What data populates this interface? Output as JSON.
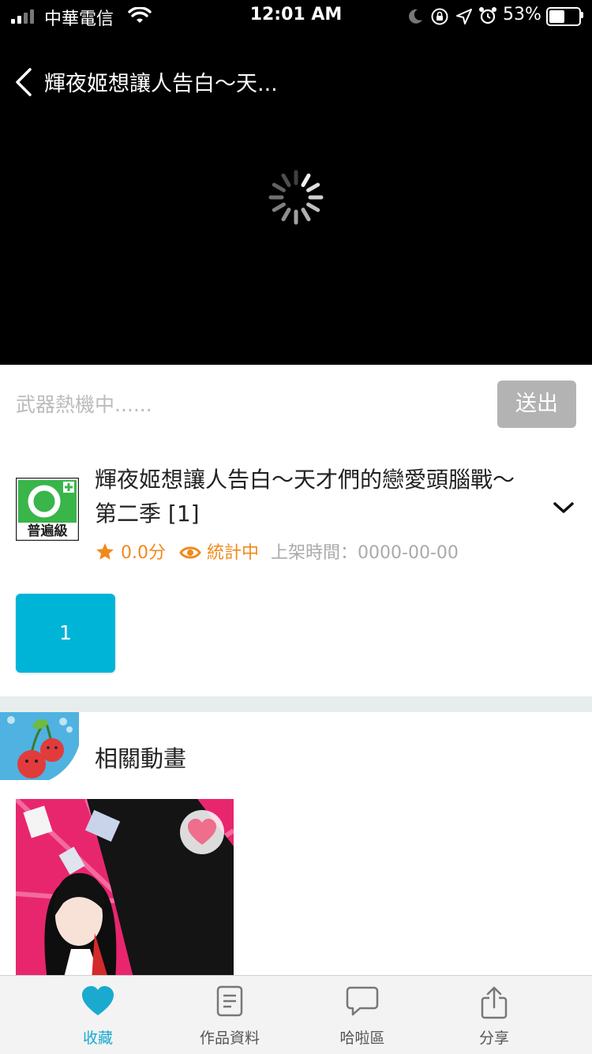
{
  "status_bar": {
    "carrier": "中華電信",
    "time": "12:01 AM",
    "battery_percent": "53%",
    "battery_level": 0.53
  },
  "nav": {
    "title": "輝夜姬想讓人告白～天...",
    "back_icon": "chevron-left-icon"
  },
  "player": {
    "state_icon": "loading-spinner-icon"
  },
  "danmaku": {
    "placeholder": "武器熱機中......",
    "send_label": "送出"
  },
  "anime": {
    "rating_badge_icon": "general-audience-rating-icon",
    "rating_badge_text": "普遍級",
    "title": "輝夜姬想讓人告白～天才們的戀愛頭腦戰～ 第二季 [1]",
    "score": "0.0分",
    "views": "統計中",
    "release_label": "上架時間：0000-00-00"
  },
  "episodes": [
    {
      "label": "1"
    }
  ],
  "related": {
    "title": "相關動畫",
    "deco_icon": "cherry-icon",
    "items": [
      {
        "thumbnail": "anime-cover",
        "favorite_icon": "heart-icon"
      }
    ]
  },
  "tabbar": {
    "tabs": [
      {
        "label": "收藏",
        "icon": "heart-icon",
        "active": true,
        "color": "#1aaad0"
      },
      {
        "label": "作品資料",
        "icon": "document-icon",
        "active": false
      },
      {
        "label": "哈啦區",
        "icon": "chat-bubble-icon",
        "active": false
      },
      {
        "label": "分享",
        "icon": "share-icon",
        "active": false
      }
    ]
  },
  "colors": {
    "accent": "#00b4d8",
    "orange": "#f08a1c",
    "send_disabled": "#b3b3b3",
    "video_bg": "#000000"
  }
}
